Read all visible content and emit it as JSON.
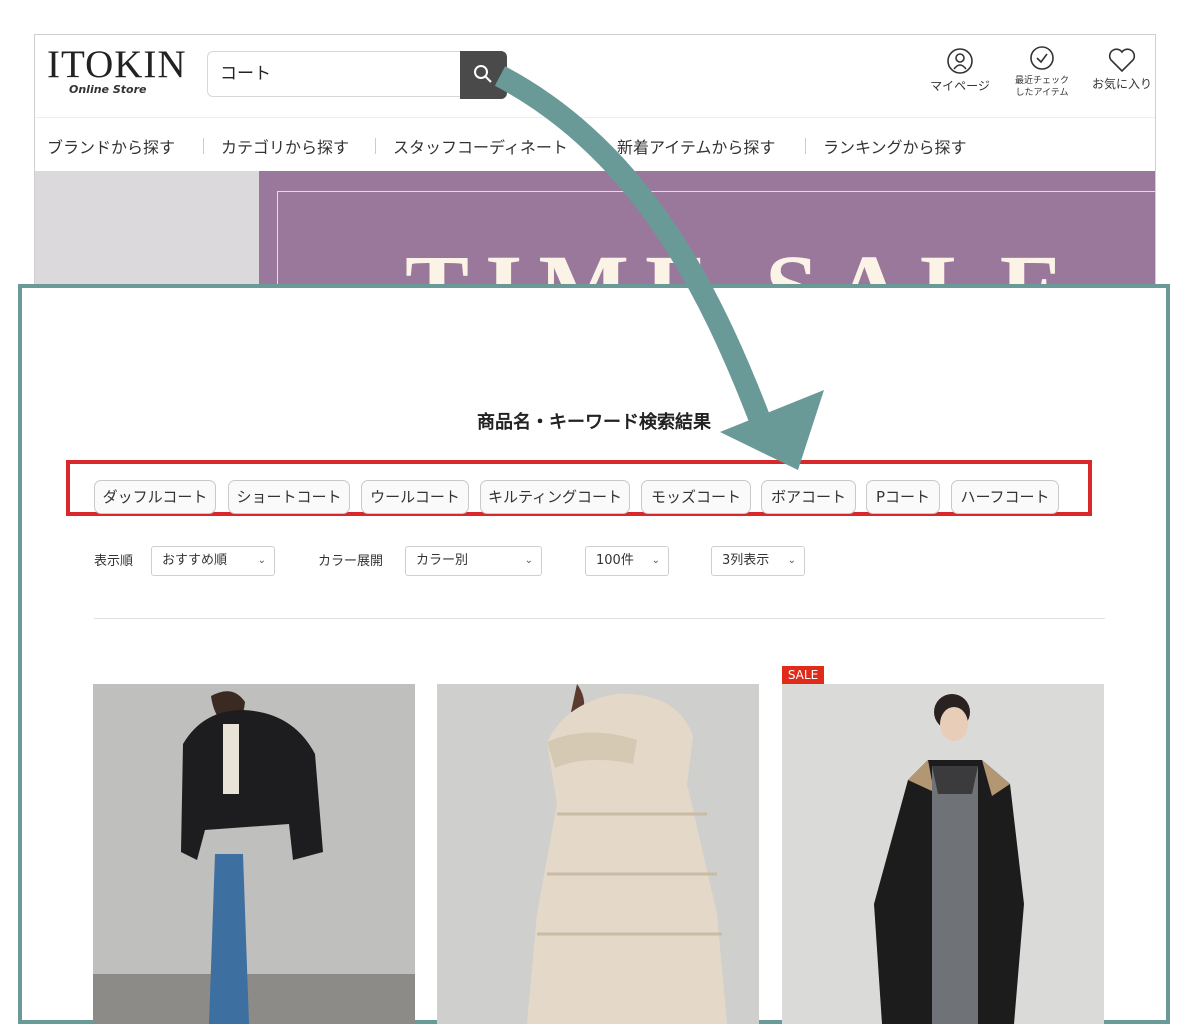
{
  "site": {
    "logo": "ITOKIN",
    "logo_sub": "Online Store",
    "search_value": "コート",
    "header_icons": [
      {
        "name": "mypage",
        "label": "マイページ"
      },
      {
        "name": "recent",
        "label_line1": "最近チェック",
        "label_line2": "したアイテム"
      },
      {
        "name": "favorites",
        "label": "お気に入り"
      }
    ],
    "nav": [
      "ブランドから探す",
      "カテゴリから探す",
      "スタッフコーディネート",
      "新着アイテムから探す",
      "ランキングから探す"
    ],
    "banner_text": "TIME SALE"
  },
  "results": {
    "title": "商品名・キーワード検索結果",
    "chips": [
      "ダッフルコート",
      "ショートコート",
      "ウールコート",
      "キルティングコート",
      "モッズコート",
      "ボアコート",
      "Pコート",
      "ハーフコート"
    ],
    "controls": {
      "sort_label": "表示順",
      "sort_value": "おすすめ順",
      "color_label": "カラー展開",
      "color_value": "カラー別",
      "count_value": "100件",
      "columns_value": "3列表示"
    },
    "products": [
      {
        "image": "black-puffer-jacket-photo",
        "sale": false
      },
      {
        "image": "beige-long-puffer-photo",
        "sale": false
      },
      {
        "image": "black-hooded-coat-photo",
        "sale": true,
        "badge": "SALE"
      }
    ]
  },
  "colors": {
    "panel_border": "#6a9a98",
    "highlight_border": "#d8282b",
    "banner_bg": "#9a789b",
    "sale_badge": "#e02b1b",
    "search_button": "#4a4a4a"
  }
}
